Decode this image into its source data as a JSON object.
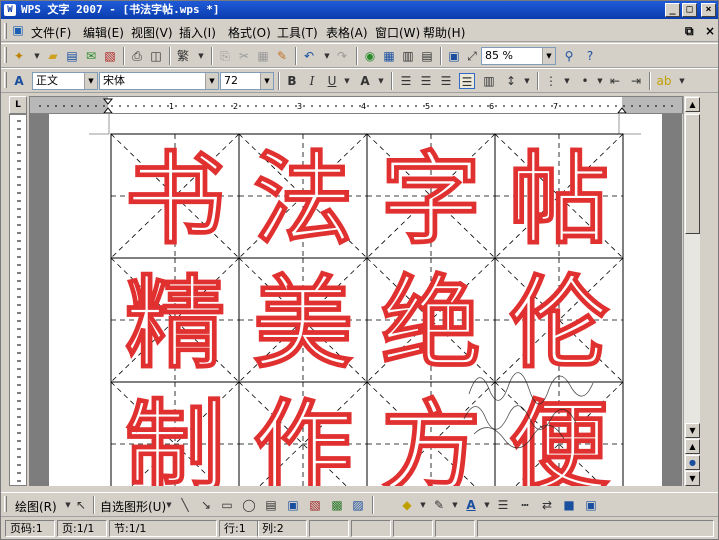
{
  "window": {
    "title": "WPS 文字 2007 - [书法字帖.wps *]",
    "app_icon": "W",
    "minimize": "_",
    "maximize": "□",
    "close": "×"
  },
  "menubar": {
    "items": [
      "文件(F)",
      "编辑(E)",
      "视图(V)",
      "插入(I)",
      "格式(O)",
      "工具(T)",
      "表格(A)",
      "窗口(W)",
      "帮助(H)"
    ],
    "doc_close": "×",
    "doc_restore": "⧉"
  },
  "toolbar_standard": {
    "icons": [
      "new-icon",
      "open-icon",
      "save-icon",
      "mail-icon",
      "pdf-icon",
      "print-icon",
      "print-preview-icon",
      "format-painter-icon",
      "cut-icon",
      "copy-icon",
      "paste-icon",
      "brush-icon",
      "undo-icon",
      "redo-icon",
      "hyperlink-icon",
      "table-icon",
      "columns-icon",
      "show-marks-icon",
      "image-icon",
      "zoom-icon",
      "find-icon",
      "help-icon"
    ],
    "zoom": "85 %"
  },
  "toolbar_format": {
    "style": "正文",
    "font": "宋体",
    "size": "72",
    "bold": "B",
    "italic": "I",
    "underline": "U",
    "fontcolor": "A"
  },
  "page": {
    "characters": [
      "书",
      "法",
      "字",
      "帖",
      "精",
      "美",
      "绝",
      "伦",
      "制",
      "作",
      "方",
      "便"
    ],
    "grid_color": "#000000",
    "guide_color": "#000000",
    "stroke_color": "#e03030"
  },
  "drawbar": {
    "draw_label": "绘图(R)",
    "autoshape_label": "自选图形(U)"
  },
  "status": {
    "page": "页码:1",
    "pages": "页:1/1",
    "section": "节:1/1",
    "line": "行:1",
    "column": "列:2"
  }
}
